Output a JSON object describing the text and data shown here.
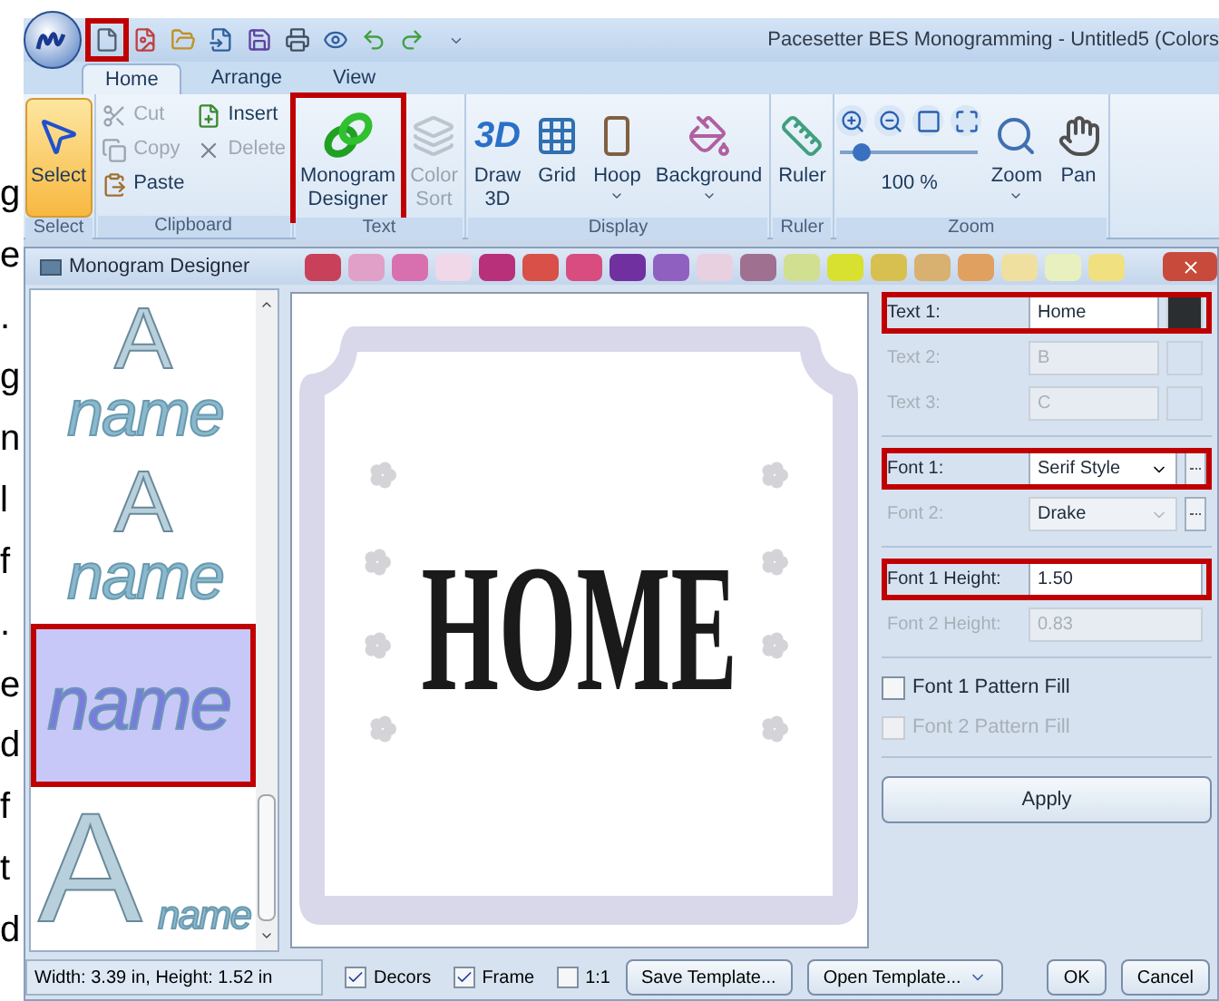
{
  "margin_fragments": [
    "g",
    "e",
    ".",
    "g",
    "n",
    "l",
    "f",
    ".",
    "e",
    "d",
    "f",
    "t",
    "d"
  ],
  "quick_access": [
    {
      "highlighted": true
    },
    {
      "highlighted": false
    },
    {
      "highlighted": false
    },
    {
      "highlighted": false
    },
    {
      "highlighted": false
    },
    {
      "highlighted": false
    },
    {
      "highlighted": false
    },
    {
      "highlighted": false
    },
    {
      "highlighted": false
    }
  ],
  "window": {
    "title": "Pacesetter BES Monogramming - Untitled5 (Colors"
  },
  "tabs": [
    {
      "label": "Home",
      "selected": true
    },
    {
      "label": "Arrange",
      "selected": false
    },
    {
      "label": "View",
      "selected": false
    }
  ],
  "ribbon": [
    {
      "label": "Select",
      "columns": [
        [
          {
            "kind": "large",
            "lines": [
              "Select"
            ],
            "selected": true,
            "disabled": false,
            "highlighted": false,
            "menu": false
          }
        ]
      ]
    },
    {
      "label": "Clipboard",
      "columns": [
        [
          {
            "kind": "small",
            "label": "Cut",
            "disabled": true
          },
          {
            "kind": "small",
            "label": "Copy",
            "disabled": true
          },
          {
            "kind": "small",
            "label": "Paste",
            "disabled": false
          }
        ],
        [
          {
            "kind": "small",
            "label": "Insert",
            "disabled": false
          },
          {
            "kind": "small",
            "label": "Delete",
            "disabled": true
          }
        ]
      ]
    },
    {
      "label": "Text",
      "columns": [
        [
          {
            "kind": "large",
            "lines": [
              "Monogram",
              "Designer"
            ],
            "selected": false,
            "disabled": false,
            "highlighted": true,
            "menu": false
          }
        ],
        [
          {
            "kind": "large",
            "lines": [
              "Color",
              "Sort"
            ],
            "selected": false,
            "disabled": true,
            "highlighted": false,
            "menu": false
          }
        ]
      ]
    },
    {
      "label": "Display",
      "columns": [
        [
          {
            "kind": "large",
            "glyph": "3D",
            "lines": [
              "Draw",
              "3D"
            ],
            "selected": false,
            "disabled": false,
            "highlighted": false,
            "menu": false
          }
        ],
        [
          {
            "kind": "large",
            "lines": [
              "Grid"
            ],
            "selected": false,
            "disabled": false,
            "highlighted": false,
            "menu": false
          }
        ],
        [
          {
            "kind": "large",
            "lines": [
              "Hoop"
            ],
            "selected": false,
            "disabled": false,
            "highlighted": false,
            "menu": true
          }
        ],
        [
          {
            "kind": "large",
            "lines": [
              "Background"
            ],
            "selected": false,
            "disabled": false,
            "highlighted": false,
            "menu": true
          }
        ]
      ]
    },
    {
      "label": "Ruler",
      "columns": [
        [
          {
            "kind": "large",
            "lines": [
              "Ruler"
            ],
            "selected": false,
            "disabled": false,
            "highlighted": false,
            "menu": false
          }
        ]
      ]
    },
    {
      "label": "Zoom",
      "columns": [
        [
          {
            "kind": "zoom",
            "level": 0.15,
            "reading": "100 %"
          }
        ],
        [
          {
            "kind": "large",
            "lines": [
              "Zoom"
            ],
            "selected": false,
            "disabled": false,
            "highlighted": false,
            "menu": true
          }
        ],
        [
          {
            "kind": "large",
            "lines": [
              "Pan"
            ],
            "selected": false,
            "disabled": false,
            "highlighted": false,
            "menu": false
          }
        ]
      ]
    }
  ],
  "dialog": {
    "title": "Monogram Designer",
    "palette": [
      {
        "color": "#c8405a"
      },
      {
        "color": "#e0a0c8"
      },
      {
        "color": "#d870b0"
      },
      {
        "color": "#f0d8e8"
      },
      {
        "color": "#b8307a"
      },
      {
        "color": "#d85048"
      },
      {
        "color": "#d84c80"
      },
      {
        "color": "#7030a0"
      },
      {
        "color": "#9060c0"
      },
      {
        "color": "#e8d0e0"
      },
      {
        "color": "#a07090"
      },
      {
        "color": "#d0e090"
      },
      {
        "color": "#d8e030"
      },
      {
        "color": "#d8c050"
      },
      {
        "color": "#d8b070"
      },
      {
        "color": "#e0a060"
      },
      {
        "color": "#f0e0a0"
      },
      {
        "color": "#e8f0c0"
      },
      {
        "color": "#f0e080"
      }
    ],
    "thumbnails": [
      {
        "kind": "overlay",
        "letter": "A",
        "text": "name",
        "selected": false,
        "highlighted": false
      },
      {
        "kind": "overlay",
        "letter": "A",
        "text": "name",
        "selected": false,
        "highlighted": false
      },
      {
        "kind": "name",
        "text": "name",
        "selected": true,
        "highlighted": true
      },
      {
        "kind": "corner",
        "letter": "A",
        "text": "name",
        "selected": false,
        "highlighted": false
      }
    ],
    "canvas": {
      "text": "HOME"
    },
    "sections": [
      [
        {
          "kind": "text",
          "label": "Text 1:",
          "value": "Home",
          "color": "#2a2e30",
          "disabled": false,
          "highlighted": true
        },
        {
          "kind": "text",
          "label": "Text 2:",
          "value": "B",
          "disabled": true,
          "highlighted": false
        },
        {
          "kind": "text",
          "label": "Text 3:",
          "value": "C",
          "disabled": true,
          "highlighted": false
        }
      ],
      [
        {
          "kind": "font",
          "label": "Font 1:",
          "value": "Serif Style",
          "disabled": false,
          "highlighted": true
        },
        {
          "kind": "font",
          "label": "Font 2:",
          "value": "Drake",
          "disabled": true,
          "highlighted": false
        }
      ],
      [
        {
          "kind": "number",
          "label": "Font 1 Height:",
          "value": "1.50",
          "disabled": false,
          "highlighted": true
        },
        {
          "kind": "number",
          "label": "Font 2 Height:",
          "value": "0.83",
          "disabled": true,
          "highlighted": false
        }
      ],
      [
        {
          "kind": "checkbox",
          "label": "Font 1 Pattern Fill",
          "checked": false,
          "disabled": false
        },
        {
          "kind": "checkbox",
          "label": "Font 2 Pattern Fill",
          "checked": false,
          "disabled": true
        }
      ]
    ],
    "apply_button": "Apply",
    "status": "Width: 3.39 in, Height: 1.52 in",
    "options": [
      {
        "label": "Decors",
        "checked": true
      },
      {
        "label": "Frame",
        "checked": true
      },
      {
        "label": "1:1",
        "checked": false
      }
    ],
    "buttons": [
      {
        "label": "Save Template...",
        "menu": false
      },
      {
        "label": "Open Template...",
        "menu": true
      },
      {
        "label": "OK",
        "menu": false
      },
      {
        "label": "Cancel",
        "menu": false
      }
    ]
  }
}
